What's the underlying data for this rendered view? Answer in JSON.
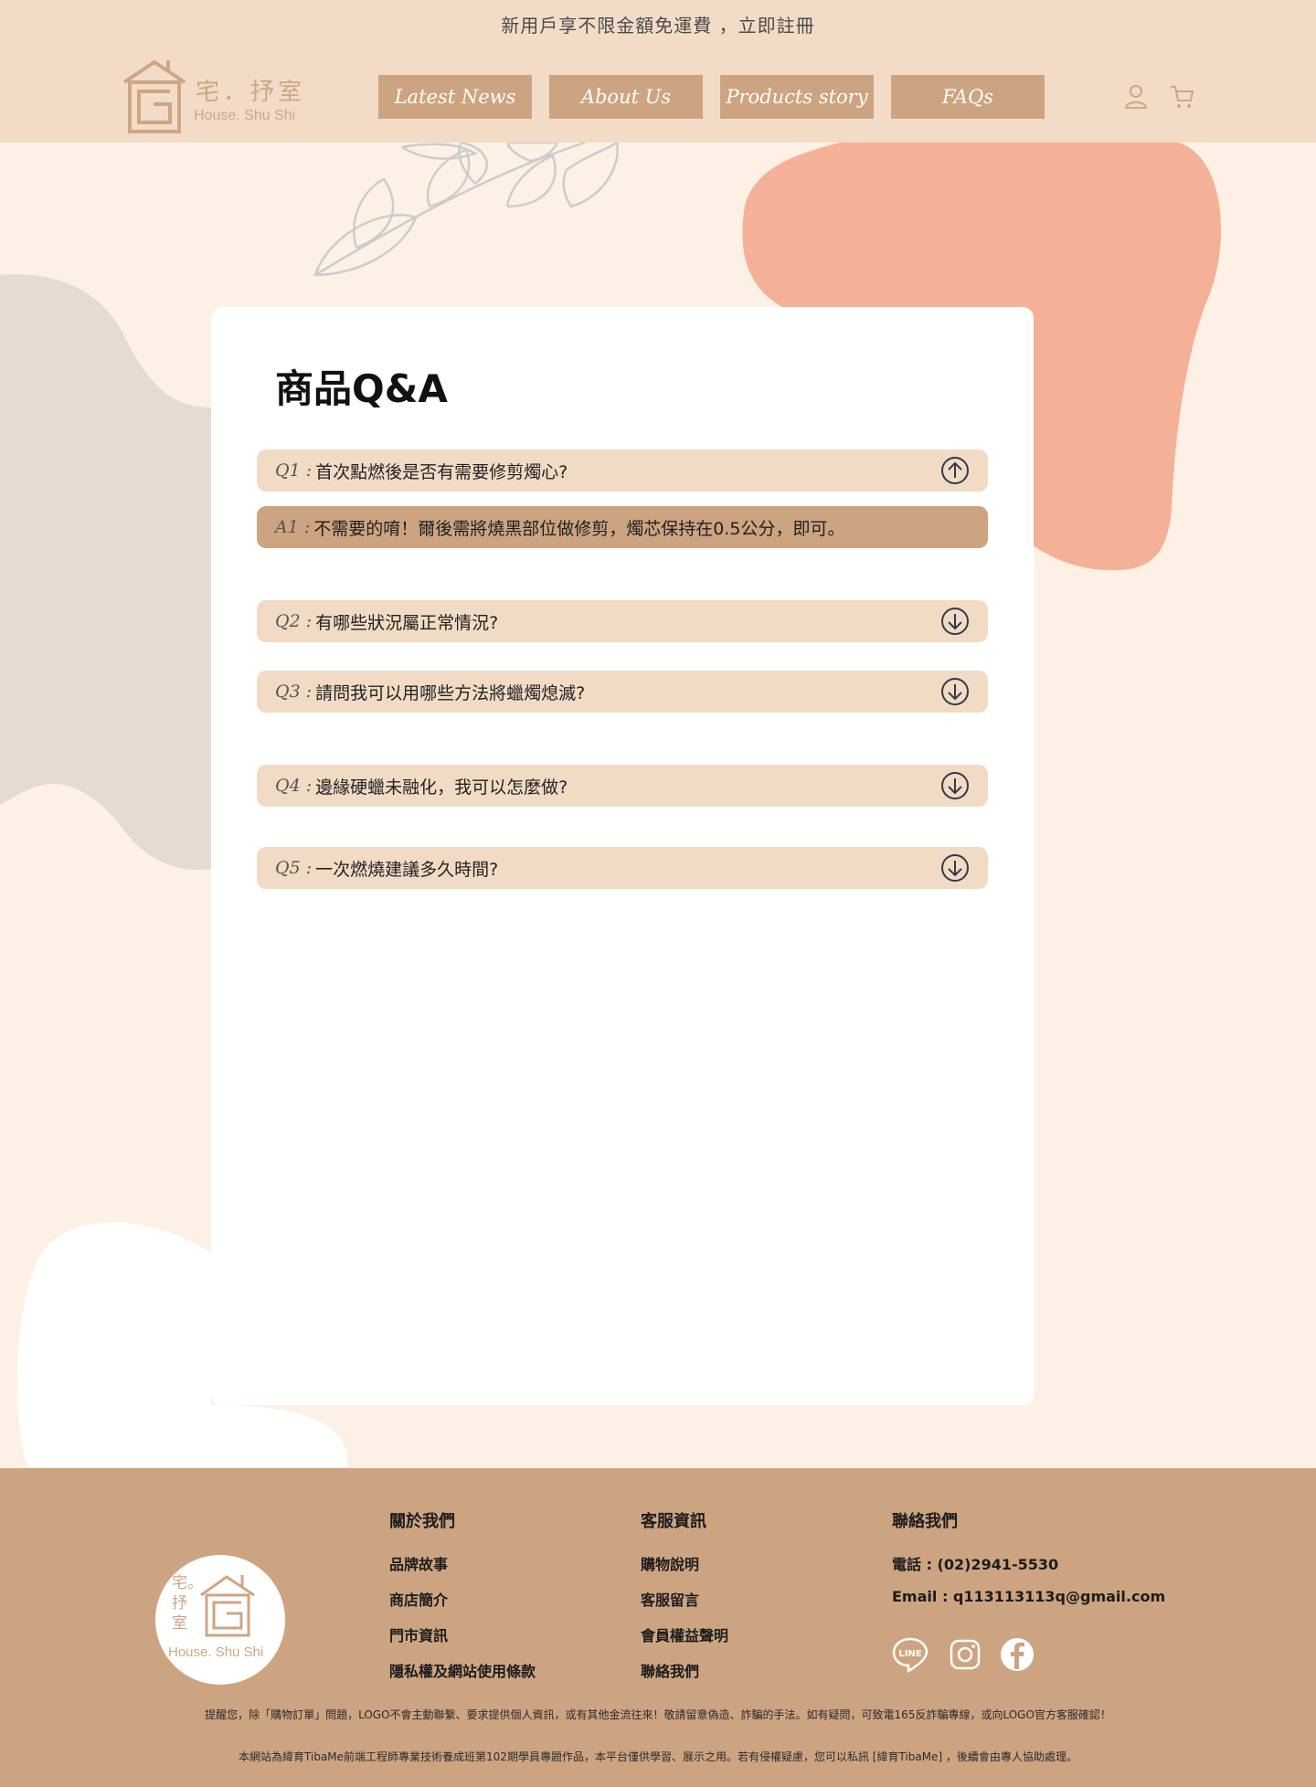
{
  "announcement": "新用戶享不限金額免運費 ，立即註冊",
  "brand": {
    "name_zh": "宅．抒室",
    "name_en": "House. Shu Shi"
  },
  "nav": [
    {
      "label": "Latest News"
    },
    {
      "label": "About Us"
    },
    {
      "label": "Products story"
    },
    {
      "label": "FAQs"
    }
  ],
  "header_icons": [
    "user-icon",
    "cart-icon"
  ],
  "faq": {
    "title": "商品Q&A",
    "items": [
      {
        "label": "Q1 :",
        "text": "首次點燃後是否有需要修剪燭心?",
        "expanded": true,
        "answer_label": "A1 :",
        "answer_text": "不需要的唷！爾後需將燒黑部位做修剪，燭芯保持在0.5公分，即可。"
      },
      {
        "label": "Q2 :",
        "text": "有哪些狀況屬正常情況?",
        "expanded": false
      },
      {
        "label": "Q3 :",
        "text": "請問我可以用哪些方法將蠟燭熄滅?",
        "expanded": false
      },
      {
        "label": "Q4 :",
        "text": "邊緣硬蠟未融化，我可以怎麼做?",
        "expanded": false
      },
      {
        "label": "Q5 :",
        "text": "一次燃燒建議多久時間?",
        "expanded": false
      }
    ]
  },
  "footer": {
    "logo_text_zh": "宅。抒室",
    "logo_text_en": "House. Shu Shi",
    "about": {
      "title": "關於我們",
      "links": [
        "品牌故事",
        "商店簡介",
        "門市資訊",
        "隱私權及網站使用條款"
      ]
    },
    "service": {
      "title": "客服資訊",
      "links": [
        "購物說明",
        "客服留言",
        "會員權益聲明",
        "聯絡我們"
      ]
    },
    "contact": {
      "title": "聯絡我們",
      "phone": "電話 : (02)2941-5530",
      "email": "Email : q113113113q@gmail.com"
    },
    "social": [
      "line-icon",
      "instagram-icon",
      "facebook-icon"
    ],
    "notice": "提醒您，除「購物訂單」問題，LOGO不會主動聯繫、要求提供個人資訊，或有其他金流往來！敬請留意偽造、詐騙的手法。如有疑問，可致電165反詐騙專線，或向LOGO官方客服確認！",
    "copyright": "本網站為緯育TibaMe前端工程師專業技術養成班第102期學員專題作品，本平台僅供學習、展示之用。若有侵權疑慮，您可以私訊 [緯育TibaMe] ，後續會由專人協助處理。"
  },
  "colors": {
    "header_bg": "#f2dcc7",
    "nav_bg": "#cda481",
    "page_bg": "#fdf0e4",
    "coral_blob": "#f4b198",
    "gray_blob": "#e6dbd3",
    "question_bg": "#f2dbc5",
    "footer_bg": "#cda481"
  }
}
